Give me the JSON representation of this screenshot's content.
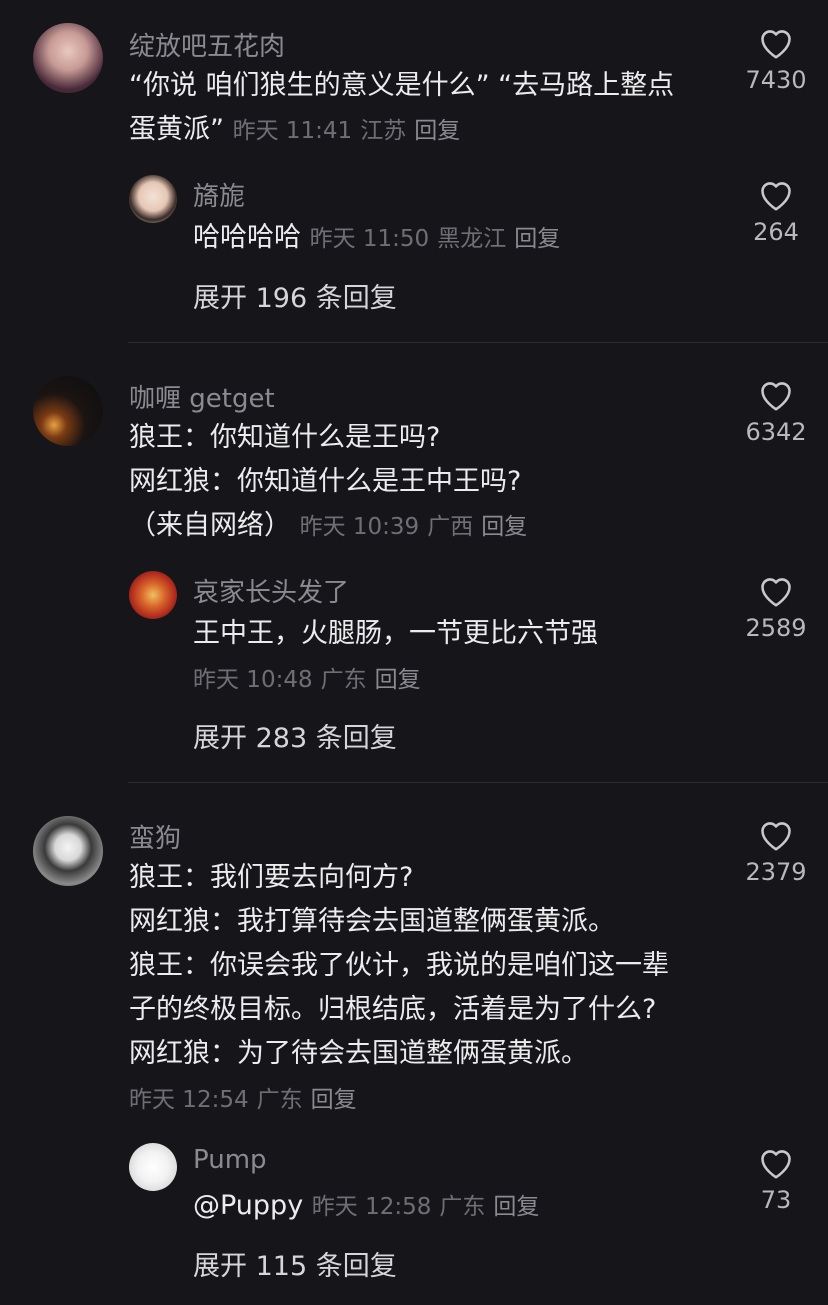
{
  "comments": [
    {
      "author": "绽放吧五花肉",
      "lines": [
        "“你说 咱们狼生的意义是什么” “去马路上整点",
        "蛋黄派”"
      ],
      "time": "昨天 11:41",
      "location": "江苏",
      "reply_label": "回复",
      "likes": "7430",
      "reply": {
        "author": "旖旎",
        "text": "哈哈哈哈",
        "time": "昨天 11:50",
        "location": "黑龙江",
        "reply_label": "回复",
        "likes": "264"
      },
      "expand_label": "展开 196 条回复"
    },
    {
      "author": "咖喱 getget",
      "lines": [
        "狼王：你知道什么是王吗?",
        "网红狼：你知道什么是王中王吗?",
        "（来自网络）"
      ],
      "time": "昨天 10:39",
      "location": "广西",
      "reply_label": "回复",
      "likes": "6342",
      "reply": {
        "author": "哀家长头发了",
        "text": "王中王，火腿肠，一节更比六节强",
        "time": "昨天 10:48",
        "location": "广东",
        "reply_label": "回复",
        "likes": "2589"
      },
      "expand_label": "展开 283 条回复"
    },
    {
      "author": "蛮狗",
      "lines": [
        "狼王：我们要去向何方?",
        "网红狼：我打算待会去国道整俩蛋黄派。",
        "狼王：你误会我了伙计，我说的是咱们这一辈",
        "子的终极目标。归根结底，活着是为了什么?",
        "网红狼：为了待会去国道整俩蛋黄派。"
      ],
      "time": "昨天 12:54",
      "location": "广东",
      "reply_label": "回复",
      "likes": "2379",
      "reply": {
        "author": "Pump",
        "text": "@Puppy",
        "time": "昨天 12:58",
        "location": "广东",
        "reply_label": "回复",
        "likes": "73"
      },
      "expand_label": "展开 115 条回复"
    }
  ],
  "icons": {
    "like": "heart-outline-icon"
  },
  "colors": {
    "background": "#16161a",
    "text": "#ececee",
    "meta": "#6e6e75"
  }
}
